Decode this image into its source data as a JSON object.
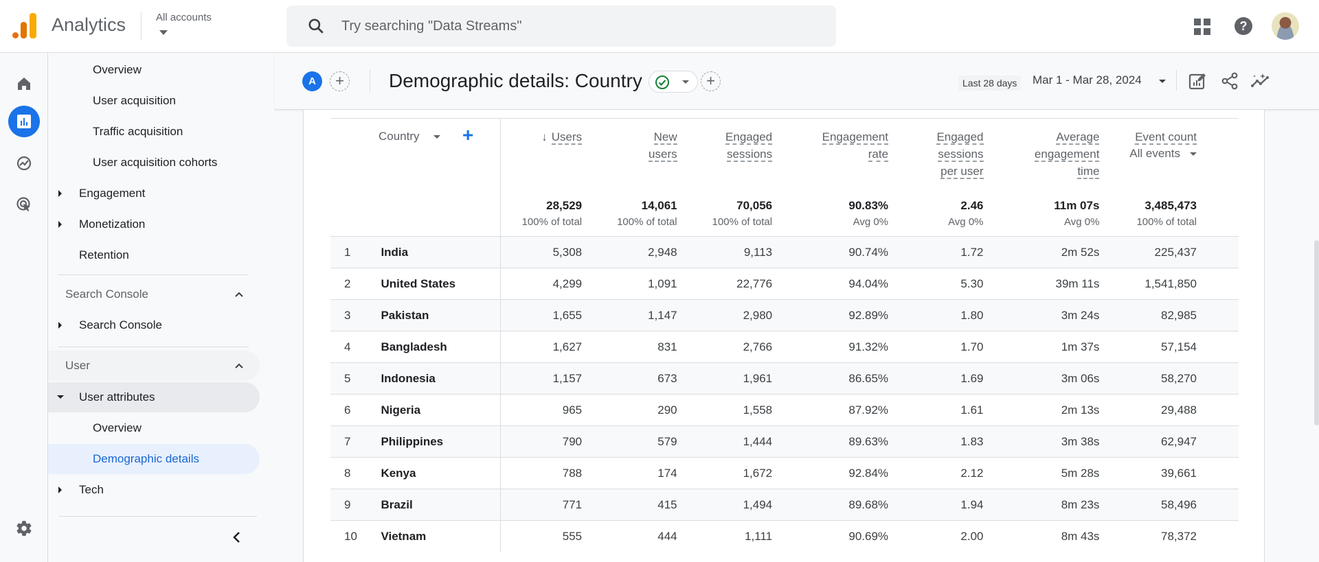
{
  "topbar": {
    "app_name": "Analytics",
    "account_selector": "All accounts",
    "search_placeholder": "Try searching \"Data Streams\"",
    "icons": [
      "apps-grid-icon",
      "help-icon",
      "user-avatar"
    ]
  },
  "rail": {
    "items": [
      {
        "name": "home-icon",
        "active": false
      },
      {
        "name": "reports-icon",
        "active": true
      },
      {
        "name": "explore-icon",
        "active": false
      },
      {
        "name": "advertising-icon",
        "active": false
      }
    ],
    "settings_icon": "gear-icon"
  },
  "sidebar": {
    "items": [
      {
        "label": "Overview",
        "level": "sub"
      },
      {
        "label": "User acquisition",
        "level": "sub"
      },
      {
        "label": "Traffic acquisition",
        "level": "sub"
      },
      {
        "label": "User acquisition cohorts",
        "level": "sub"
      },
      {
        "label": "Engagement",
        "level": "top",
        "expander": "collapsed"
      },
      {
        "label": "Monetization",
        "level": "top",
        "expander": "collapsed"
      },
      {
        "label": "Retention",
        "level": "top"
      }
    ],
    "section_search_console": {
      "label": "Search Console",
      "items": [
        {
          "label": "Search Console",
          "expander": "collapsed"
        }
      ]
    },
    "section_user": {
      "label": "User",
      "items": [
        {
          "label": "User attributes",
          "expander": "expanded"
        },
        {
          "label": "Overview"
        },
        {
          "label": "Demographic details",
          "active": true
        },
        {
          "label": "Tech",
          "expander": "collapsed"
        }
      ]
    }
  },
  "header": {
    "segment_badge": "A",
    "title": "Demographic details: Country",
    "date_preset": "Last 28 days",
    "date_range": "Mar 1 - Mar 28, 2024",
    "status_color": "#188038",
    "accent_color": "#1a73e8"
  },
  "table": {
    "dimension": "Country",
    "sort_indicator": "↓",
    "columns": [
      {
        "label_lines": [
          "Users"
        ],
        "sorted": true
      },
      {
        "label_lines": [
          "New",
          "users"
        ]
      },
      {
        "label_lines": [
          "Engaged",
          "sessions"
        ]
      },
      {
        "label_lines": [
          "Engagement",
          "rate"
        ]
      },
      {
        "label_lines": [
          "Engaged",
          "sessions",
          "per user"
        ]
      },
      {
        "label_lines": [
          "Average",
          "engagement",
          "time"
        ]
      },
      {
        "label_lines": [
          "Event count"
        ],
        "selector": "All events"
      }
    ],
    "totals": [
      {
        "value": "28,529",
        "sub": "100% of total"
      },
      {
        "value": "14,061",
        "sub": "100% of total"
      },
      {
        "value": "70,056",
        "sub": "100% of total"
      },
      {
        "value": "90.83%",
        "sub": "Avg 0%"
      },
      {
        "value": "2.46",
        "sub": "Avg 0%"
      },
      {
        "value": "11m 07s",
        "sub": "Avg 0%"
      },
      {
        "value": "3,485,473",
        "sub": "100% of total"
      }
    ],
    "rows": [
      {
        "idx": "1",
        "country": "India",
        "cells": [
          "5,308",
          "2,948",
          "9,113",
          "90.74%",
          "1.72",
          "2m 52s",
          "225,437"
        ]
      },
      {
        "idx": "2",
        "country": "United States",
        "cells": [
          "4,299",
          "1,091",
          "22,776",
          "94.04%",
          "5.30",
          "39m 11s",
          "1,541,850"
        ]
      },
      {
        "idx": "3",
        "country": "Pakistan",
        "cells": [
          "1,655",
          "1,147",
          "2,980",
          "92.89%",
          "1.80",
          "3m 24s",
          "82,985"
        ]
      },
      {
        "idx": "4",
        "country": "Bangladesh",
        "cells": [
          "1,627",
          "831",
          "2,766",
          "91.32%",
          "1.70",
          "1m 37s",
          "57,154"
        ]
      },
      {
        "idx": "5",
        "country": "Indonesia",
        "cells": [
          "1,157",
          "673",
          "1,961",
          "86.65%",
          "1.69",
          "3m 06s",
          "58,270"
        ]
      },
      {
        "idx": "6",
        "country": "Nigeria",
        "cells": [
          "965",
          "290",
          "1,558",
          "87.92%",
          "1.61",
          "2m 13s",
          "29,488"
        ]
      },
      {
        "idx": "7",
        "country": "Philippines",
        "cells": [
          "790",
          "579",
          "1,444",
          "89.63%",
          "1.83",
          "3m 38s",
          "62,947"
        ]
      },
      {
        "idx": "8",
        "country": "Kenya",
        "cells": [
          "788",
          "174",
          "1,672",
          "92.84%",
          "2.12",
          "5m 28s",
          "39,661"
        ]
      },
      {
        "idx": "9",
        "country": "Brazil",
        "cells": [
          "771",
          "415",
          "1,494",
          "89.68%",
          "1.94",
          "8m 23s",
          "58,496"
        ]
      },
      {
        "idx": "10",
        "country": "Vietnam",
        "cells": [
          "555",
          "444",
          "1,111",
          "90.69%",
          "2.00",
          "8m 43s",
          "78,372"
        ]
      }
    ]
  }
}
